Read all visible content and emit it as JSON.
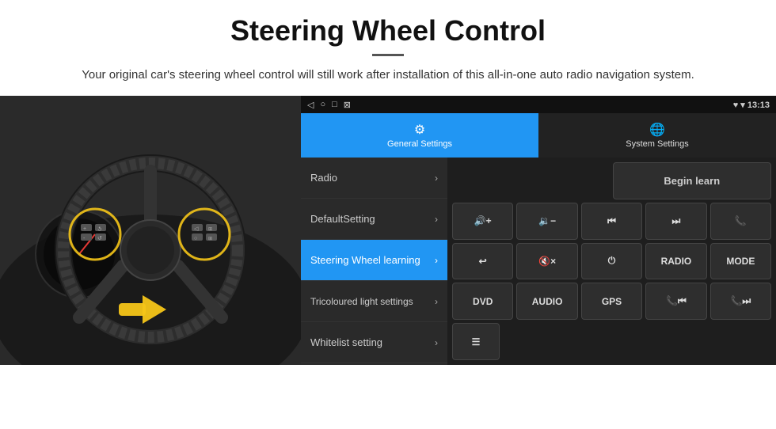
{
  "header": {
    "title": "Steering Wheel Control",
    "divider": true,
    "subtitle": "Your original car's steering wheel control will still work after installation of this all-in-one auto radio navigation system."
  },
  "statusBar": {
    "icons": [
      "◁",
      "○",
      "□",
      "⊠"
    ],
    "rightIcons": "♥ ▾",
    "time": "13:13"
  },
  "tabs": [
    {
      "id": "general",
      "label": "General Settings",
      "icon": "⚙",
      "active": true
    },
    {
      "id": "system",
      "label": "System Settings",
      "icon": "🌐",
      "active": false
    }
  ],
  "menu": [
    {
      "id": "radio",
      "label": "Radio",
      "active": false
    },
    {
      "id": "default",
      "label": "DefaultSetting",
      "active": false
    },
    {
      "id": "steering",
      "label": "Steering Wheel learning",
      "active": true
    },
    {
      "id": "tricoloured",
      "label": "Tricoloured light settings",
      "active": false
    },
    {
      "id": "whitelist",
      "label": "Whitelist setting",
      "active": false
    }
  ],
  "panel": {
    "row1": [
      {
        "id": "empty",
        "label": "",
        "empty": true
      },
      {
        "id": "begin-learn",
        "label": "Begin learn"
      }
    ],
    "row2": [
      {
        "id": "vol-up",
        "label": "🔊+"
      },
      {
        "id": "vol-down",
        "label": "🔉-"
      },
      {
        "id": "prev",
        "label": "⏮"
      },
      {
        "id": "next",
        "label": "⏭"
      },
      {
        "id": "phone",
        "label": "📞"
      }
    ],
    "row3": [
      {
        "id": "back",
        "label": "↩"
      },
      {
        "id": "mute",
        "label": "🔇×"
      },
      {
        "id": "power",
        "label": "⏻"
      },
      {
        "id": "radio-btn",
        "label": "RADIO"
      },
      {
        "id": "mode",
        "label": "MODE"
      }
    ],
    "row4": [
      {
        "id": "dvd",
        "label": "DVD"
      },
      {
        "id": "audio",
        "label": "AUDIO"
      },
      {
        "id": "gps",
        "label": "GPS"
      },
      {
        "id": "tel-prev",
        "label": "📞⏮"
      },
      {
        "id": "tel-next",
        "label": "📞⏭"
      }
    ],
    "row5": [
      {
        "id": "list-icon",
        "label": "☰"
      }
    ]
  }
}
